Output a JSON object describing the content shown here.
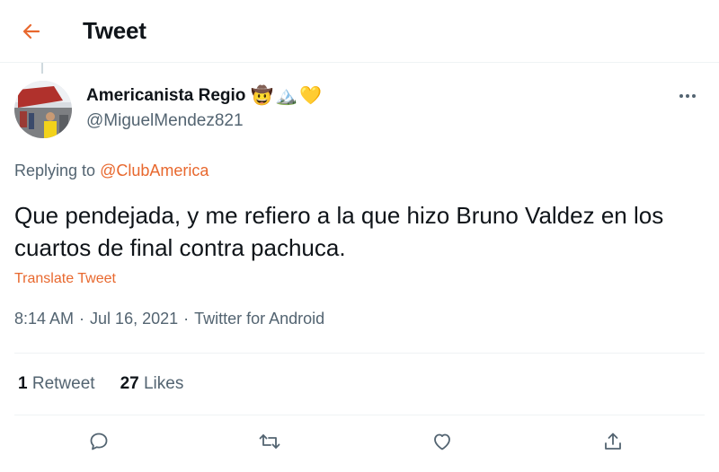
{
  "header": {
    "title": "Tweet"
  },
  "author": {
    "name": "Americanista Regio",
    "handle": "@MiguelMendez821",
    "emoji_1": "🤠",
    "emoji_2": "🏔️",
    "emoji_3": "💛"
  },
  "reply": {
    "prefix": "Replying to",
    "target": "@ClubAmerica"
  },
  "tweet": {
    "text": "Que pendejada, y me refiero a la que hizo Bruno Valdez en los cuartos de final contra pachuca.",
    "translate_label": "Translate Tweet",
    "time": "8:14 AM",
    "separator": "·",
    "date": "Jul 16, 2021",
    "source": "Twitter for Android"
  },
  "stats": {
    "retweets_count": "1",
    "retweets_label": "Retweet",
    "likes_count": "27",
    "likes_label": "Likes"
  },
  "colors": {
    "accent": "#e8682e",
    "secondary_text": "#536471",
    "primary_text": "#0f1419"
  },
  "icons": [
    "back-arrow-icon",
    "more-icon",
    "reply-icon",
    "retweet-icon",
    "like-icon",
    "share-icon"
  ]
}
